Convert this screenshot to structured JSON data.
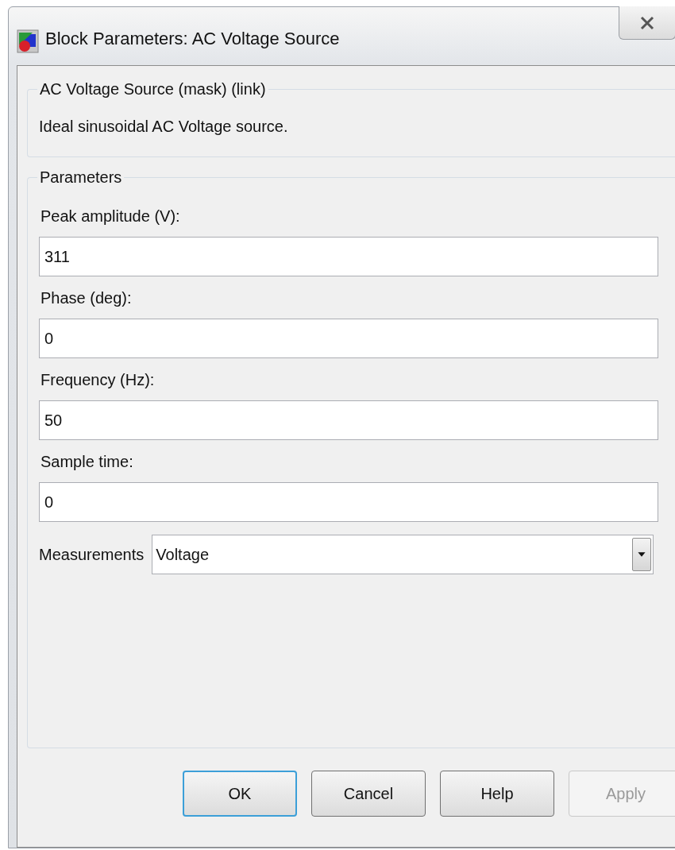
{
  "window": {
    "title": "Block Parameters: AC Voltage Source"
  },
  "description_group": {
    "title": "AC Voltage Source (mask) (link)",
    "text": "Ideal sinusoidal AC Voltage source."
  },
  "parameters_group": {
    "title": "Parameters",
    "fields": [
      {
        "label": "Peak amplitude (V):",
        "value": "311"
      },
      {
        "label": "Phase (deg):",
        "value": "0"
      },
      {
        "label": "Frequency (Hz):",
        "value": "50"
      },
      {
        "label": "Sample time:",
        "value": "0"
      }
    ],
    "measurements": {
      "label": "Measurements",
      "value": "Voltage"
    }
  },
  "buttons": [
    {
      "label": "OK",
      "default": true,
      "disabled": false
    },
    {
      "label": "Cancel",
      "default": false,
      "disabled": false
    },
    {
      "label": "Help",
      "default": false,
      "disabled": false
    },
    {
      "label": "Apply",
      "default": false,
      "disabled": true
    }
  ]
}
